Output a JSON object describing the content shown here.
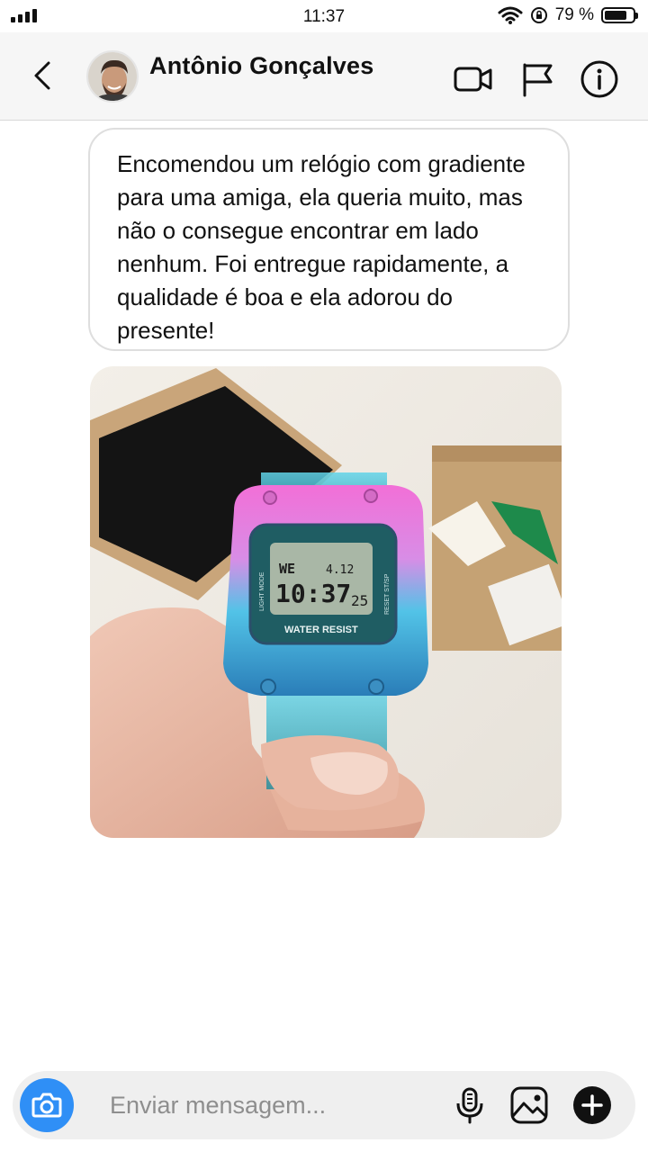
{
  "status_bar": {
    "time": "11:37",
    "battery_text": "79 %",
    "battery_level": 0.79,
    "icons": [
      "signal-icon",
      "wifi-icon",
      "rotation-lock-icon",
      "battery-icon"
    ]
  },
  "header": {
    "contact_name": "Antônio Gonçalves",
    "icons": [
      "back-icon",
      "video-call-icon",
      "flag-icon",
      "info-icon"
    ]
  },
  "message": {
    "text": "Encomendou um relógio com gradiente para uma amiga, ela queria muito, mas não o consegue encontrar em lado nenhum. Foi entregue rapidamente, a qualidade é boa e ela adorou do presente!"
  },
  "photo": {
    "watch_day": "WE",
    "watch_date": "4.12",
    "watch_time": "10:37",
    "watch_seconds": "25",
    "watch_label": "WATER RESIST",
    "watch_side_left": "LIGHT MODE",
    "watch_side_right": "RESET ST/SP"
  },
  "composer": {
    "placeholder": "Enviar mensagem...",
    "icons": [
      "camera-icon",
      "microphone-icon",
      "gallery-icon",
      "plus-icon"
    ]
  },
  "colors": {
    "accent": "#2f8ff6",
    "header_bg": "#f6f6f6",
    "composer_bg": "#efefef"
  }
}
